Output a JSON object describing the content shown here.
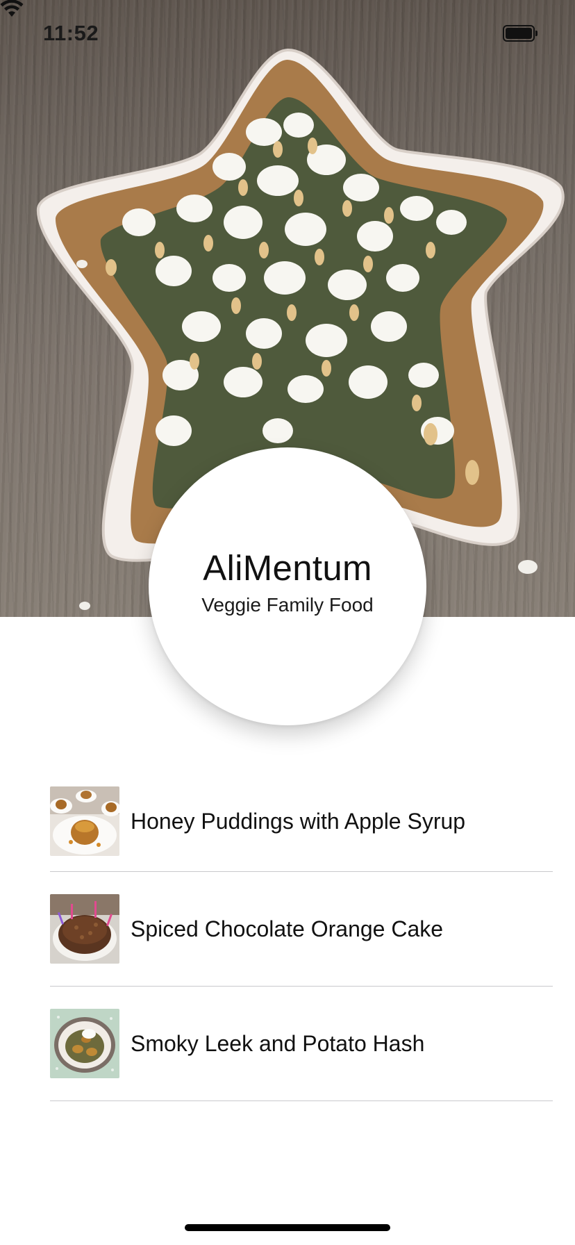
{
  "status_bar": {
    "time": "11:52",
    "icons": [
      "wifi-icon",
      "battery-icon"
    ]
  },
  "header": {
    "title": "AliMentum",
    "subtitle": "Veggie Family Food"
  },
  "recipes": [
    {
      "name": "Honey Puddings with Apple Syrup",
      "thumbnail": "honey-puddings-image"
    },
    {
      "name": "Spiced Chocolate Orange Cake",
      "thumbnail": "chocolate-cake-image"
    },
    {
      "name": "Smoky Leek and Potato Hash",
      "thumbnail": "leek-potato-hash-image"
    }
  ]
}
